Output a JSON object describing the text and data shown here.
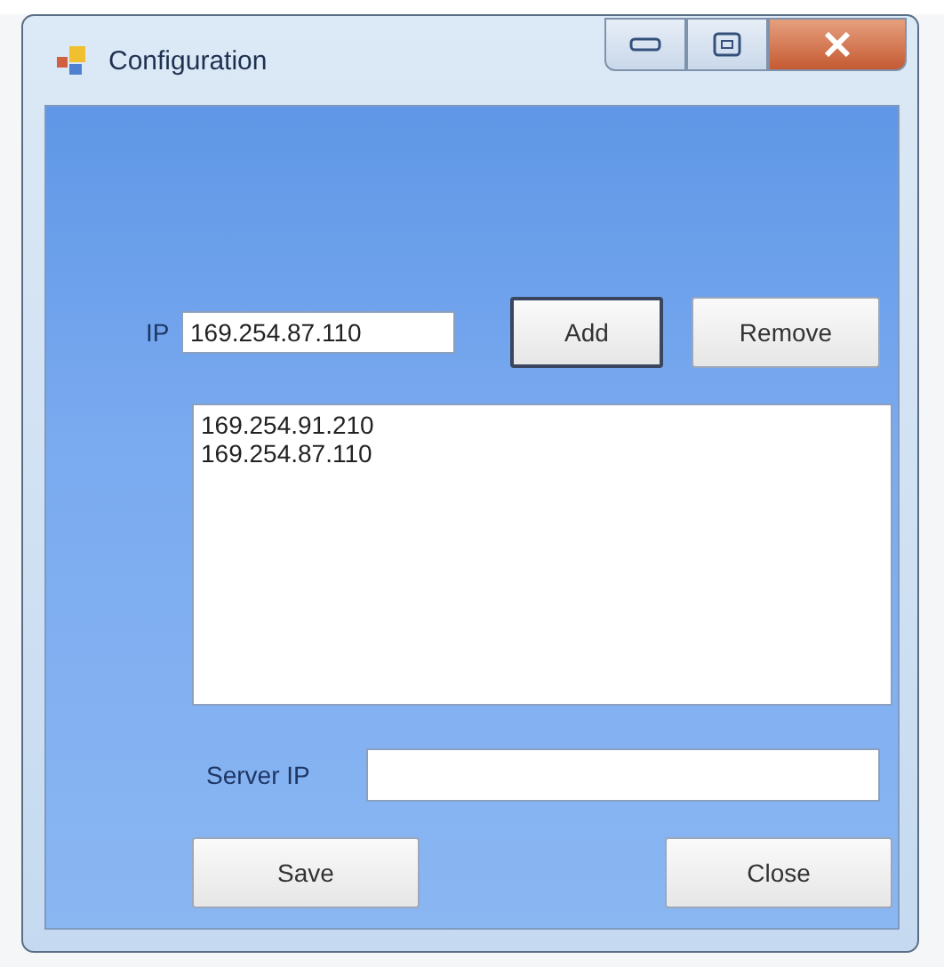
{
  "window": {
    "title": "Configuration"
  },
  "ip_field": {
    "label": "IP",
    "value": "169.254.87.110"
  },
  "ip_buttons": [
    {
      "label": "Add",
      "focused": true
    },
    {
      "label": "Remove",
      "focused": false
    }
  ],
  "ip_list": {
    "items": [
      "169.254.91.210",
      "169.254.87.110"
    ]
  },
  "server_ip_field": {
    "label": "Server IP"
  },
  "buttons": [
    {
      "label": "Save"
    },
    {
      "label": "Close"
    }
  ]
}
